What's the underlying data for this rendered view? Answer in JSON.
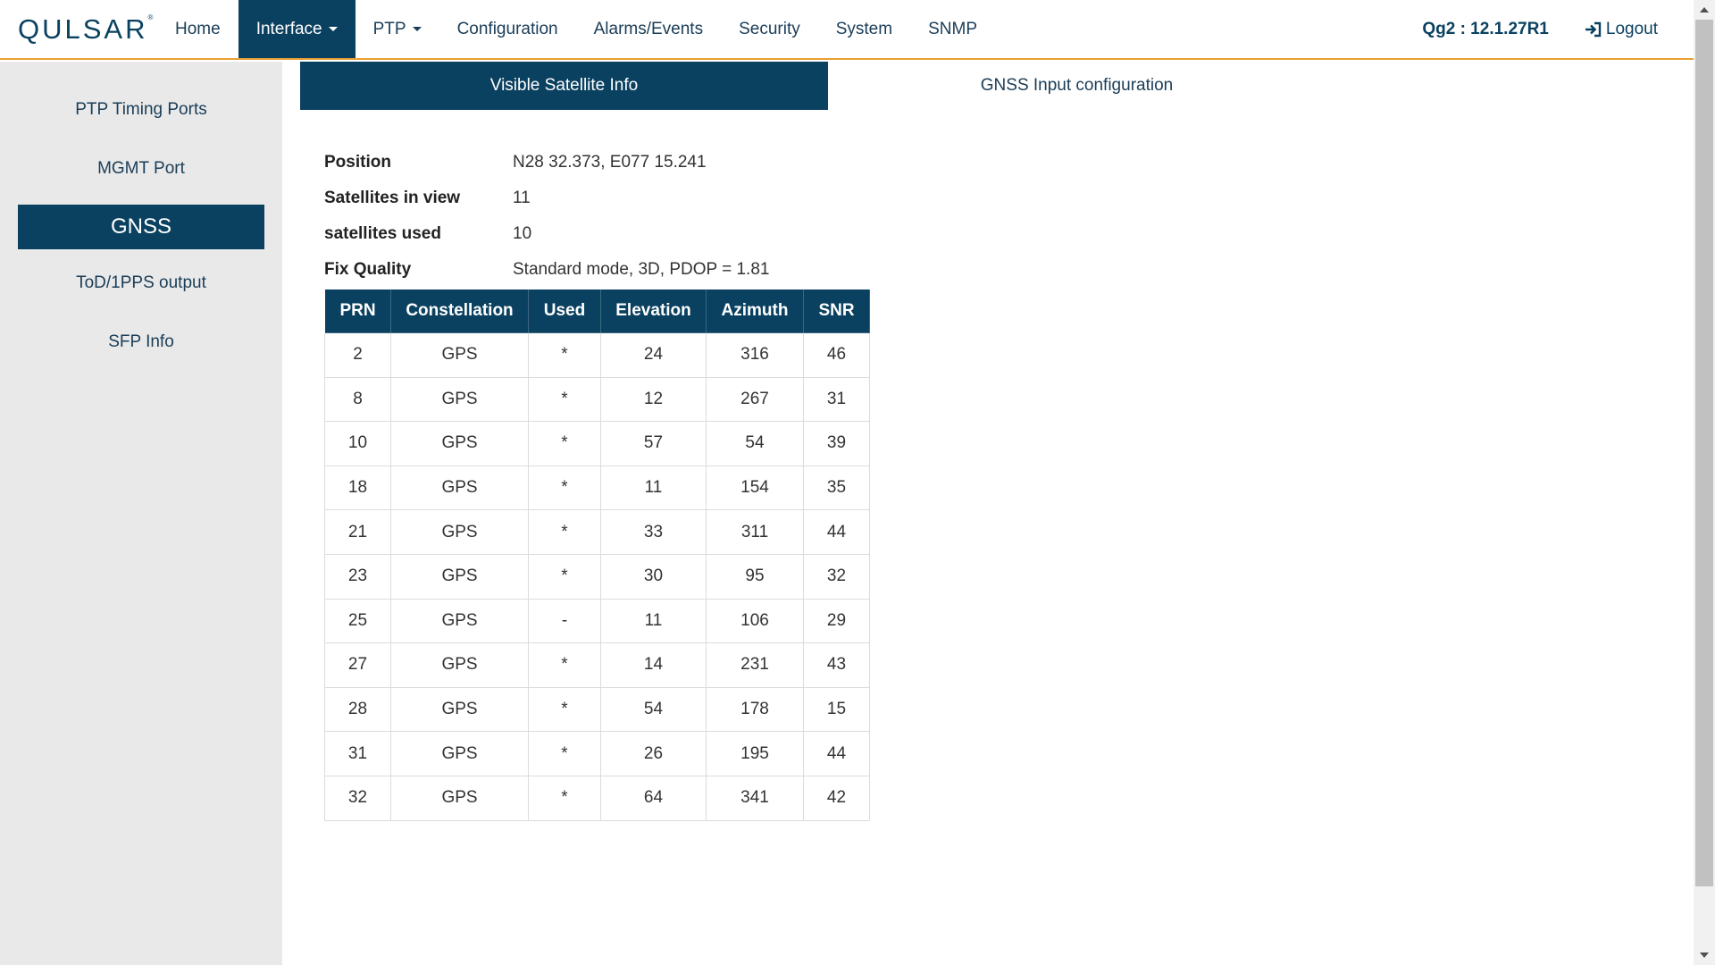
{
  "brand": {
    "logo_text": "QULSAR",
    "logo_mark": "®"
  },
  "nav": {
    "items": [
      {
        "label": "Home",
        "caret": false
      },
      {
        "label": "Interface",
        "caret": true,
        "active": true
      },
      {
        "label": "PTP",
        "caret": true
      },
      {
        "label": "Configuration",
        "caret": false
      },
      {
        "label": "Alarms/Events",
        "caret": false
      },
      {
        "label": "Security",
        "caret": false
      },
      {
        "label": "System",
        "caret": false
      },
      {
        "label": "SNMP",
        "caret": false
      }
    ],
    "version": "Qg2 : 12.1.27R1",
    "logout": "Logout"
  },
  "sidebar": {
    "items": [
      {
        "label": "PTP Timing Ports"
      },
      {
        "label": "MGMT Port"
      },
      {
        "label": "GNSS",
        "active": true
      },
      {
        "label": "ToD/1PPS output"
      },
      {
        "label": "SFP Info"
      }
    ]
  },
  "tabs": [
    {
      "label": "Visible Satellite Info",
      "active": true
    },
    {
      "label": "GNSS Input configuration",
      "active": false
    }
  ],
  "summary": {
    "position_label": "Position",
    "position_value": "N28 32.373, E077 15.241",
    "in_view_label": "Satellites in view",
    "in_view_value": "11",
    "used_label": "satellites used",
    "used_value": "10",
    "fix_label": "Fix Quality",
    "fix_value": "Standard mode, 3D, PDOP = 1.81"
  },
  "table": {
    "headers": [
      "PRN",
      "Constellation",
      "Used",
      "Elevation",
      "Azimuth",
      "SNR"
    ],
    "rows": [
      [
        "2",
        "GPS",
        "*",
        "24",
        "316",
        "46"
      ],
      [
        "8",
        "GPS",
        "*",
        "12",
        "267",
        "31"
      ],
      [
        "10",
        "GPS",
        "*",
        "57",
        "54",
        "39"
      ],
      [
        "18",
        "GPS",
        "*",
        "11",
        "154",
        "35"
      ],
      [
        "21",
        "GPS",
        "*",
        "33",
        "311",
        "44"
      ],
      [
        "23",
        "GPS",
        "*",
        "30",
        "95",
        "32"
      ],
      [
        "25",
        "GPS",
        "-",
        "11",
        "106",
        "29"
      ],
      [
        "27",
        "GPS",
        "*",
        "14",
        "231",
        "43"
      ],
      [
        "28",
        "GPS",
        "*",
        "54",
        "178",
        "15"
      ],
      [
        "31",
        "GPS",
        "*",
        "26",
        "195",
        "44"
      ],
      [
        "32",
        "GPS",
        "*",
        "64",
        "341",
        "42"
      ]
    ]
  },
  "colors": {
    "primary": "#0b4160",
    "accent": "#e8a033",
    "sidebar_bg": "#e9e9e9"
  }
}
